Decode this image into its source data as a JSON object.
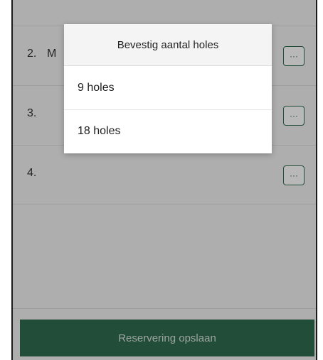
{
  "rows": [
    {
      "number": "2.",
      "name": "M",
      "more_label": "···"
    },
    {
      "number": "3.",
      "name": "",
      "more_label": "···"
    },
    {
      "number": "4.",
      "name": "",
      "more_label": "···"
    }
  ],
  "footer": {
    "save_label": "Reservering opslaan"
  },
  "dialog": {
    "title": "Bevestig aantal holes",
    "options": [
      {
        "label": "9 holes"
      },
      {
        "label": "18 holes"
      }
    ]
  },
  "colors": {
    "accent": "#2f6b4f",
    "background": "#f2f2f2"
  }
}
